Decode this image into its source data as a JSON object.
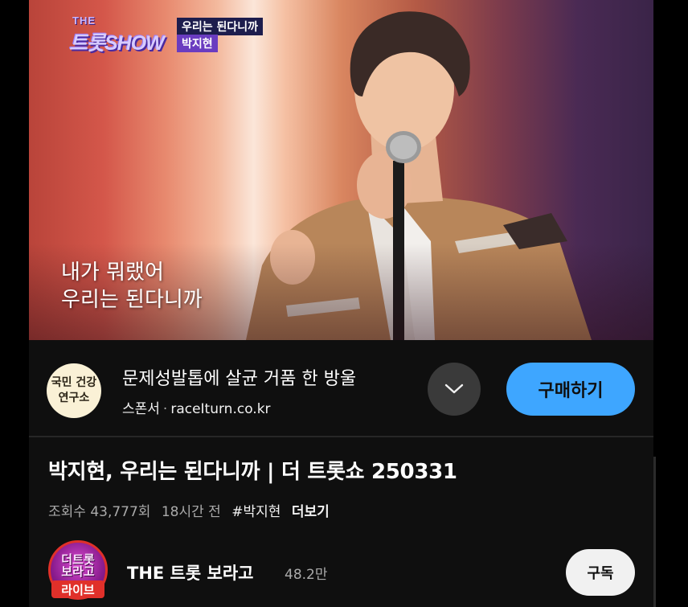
{
  "video": {
    "show_logo_small": "THE",
    "show_logo_main": "트롯SHOW",
    "caption_song": "우리는 된다니까",
    "caption_artist": "박지현",
    "lyrics": [
      "내가 뭐랬어",
      "우리는 된다니까"
    ]
  },
  "ad": {
    "logo_lines": [
      "국민 건강",
      "연구소"
    ],
    "title": "문제성발톱에 살균 거품 한 방울",
    "sponsor_label": "스폰서",
    "separator": "·",
    "domain": "raceIturn.co.kr",
    "expand_icon": "chevron-down-icon",
    "buy_label": "구매하기"
  },
  "info": {
    "title": "박지현, 우리는 된다니까 | 더 트롯쇼 250331",
    "views": "조회수 43,777회",
    "age": "18시간 전",
    "hashtag": "#박지현",
    "more": "더보기"
  },
  "channel": {
    "avatar_text_1": "더트롯",
    "avatar_text_2": "보라고",
    "live_badge": "라이브",
    "name": "THE 트롯 보라고",
    "subscribers": "48.2만",
    "subscribe_label": "구독"
  },
  "colors": {
    "background": "#0f0f0f",
    "accent_blue": "#3ea6ff",
    "live_red": "#e0302a",
    "muted_text": "#aaaaaa"
  }
}
